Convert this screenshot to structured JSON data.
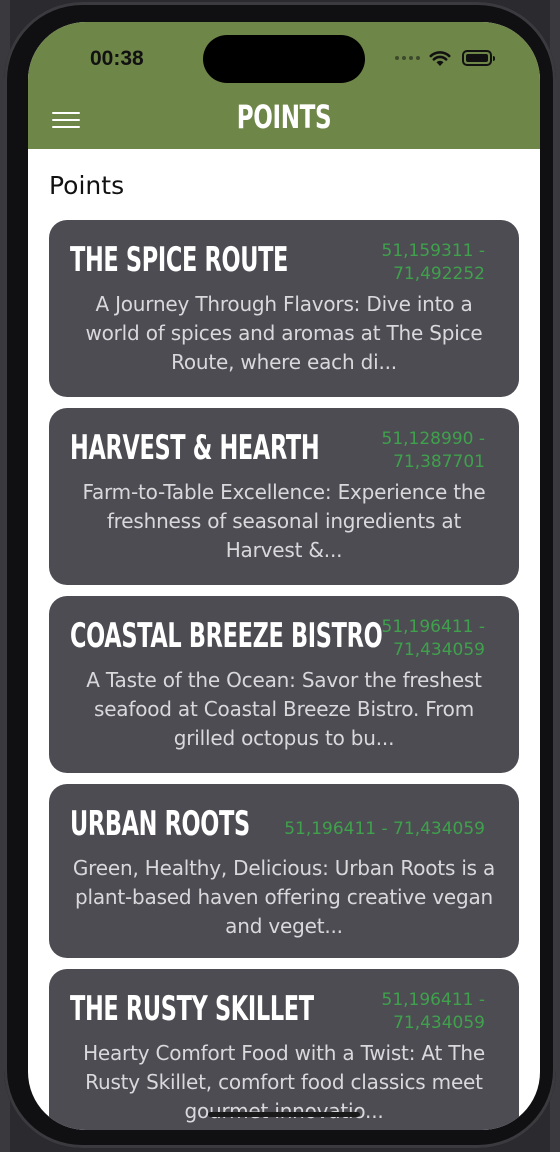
{
  "status_bar": {
    "time": "00:38"
  },
  "header": {
    "title": "POINTS"
  },
  "page": {
    "title": "Points"
  },
  "points": [
    {
      "name": "THE SPICE ROUTE",
      "coords": "51,159311 - 71,492252",
      "description": "A Journey Through Flavors: Dive into a world of spices and aromas at The Spice Route, where each di..."
    },
    {
      "name": "HARVEST & HEARTH",
      "coords": "51,128990 - 71,387701",
      "description": "Farm-to-Table Excellence: Experience the freshness of seasonal ingredients at Harvest &..."
    },
    {
      "name": "COASTAL BREEZE BISTRO",
      "coords": "51,196411 - 71,434059",
      "description": "A Taste of the Ocean: Savor the freshest seafood at Coastal Breeze Bistro. From grilled octopus to bu..."
    },
    {
      "name": "URBAN ROOTS",
      "coords": "51,196411 - 71,434059",
      "description": "Green, Healthy, Delicious: Urban Roots is a plant-based haven offering creative vegan and veget..."
    },
    {
      "name": "THE RUSTY SKILLET",
      "coords": "51,196411 - 71,434059",
      "description": "Hearty Comfort Food with a Twist: At The Rusty Skillet, comfort food classics meet gourmet innovatio..."
    }
  ],
  "colors": {
    "header_bg": "#6f8649",
    "card_bg": "#4d4c53",
    "coords_text": "#3fa14c"
  }
}
